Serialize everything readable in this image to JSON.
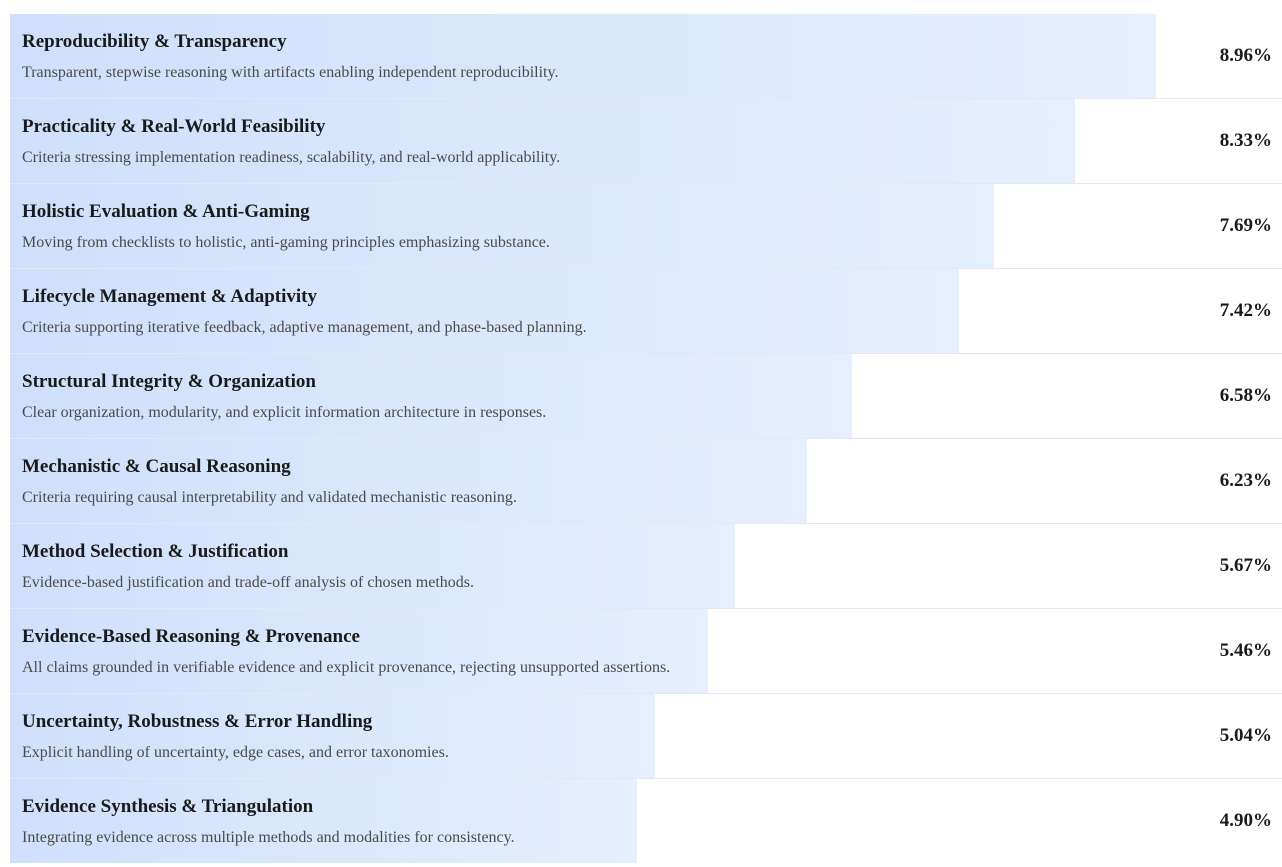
{
  "chart_data": {
    "type": "bar",
    "orientation": "horizontal",
    "xlim": [
      0,
      8.96
    ],
    "colors": {
      "bar_start": "#cfe0fc",
      "bar_end": "#e6effd",
      "text": "#1a1a1a",
      "subtext": "#4a4a4a",
      "divider": "#e6e8ee"
    },
    "rows": [
      {
        "title": "Reproducibility & Transparency",
        "description": "Transparent, stepwise reasoning with artifacts enabling independent reproducibility.",
        "value": 8.96,
        "label": "8.96%"
      },
      {
        "title": "Practicality & Real-World Feasibility",
        "description": "Criteria stressing implementation readiness, scalability, and real-world applicability.",
        "value": 8.33,
        "label": "8.33%"
      },
      {
        "title": "Holistic Evaluation & Anti-Gaming",
        "description": "Moving from checklists to holistic, anti-gaming principles emphasizing substance.",
        "value": 7.69,
        "label": "7.69%"
      },
      {
        "title": "Lifecycle Management & Adaptivity",
        "description": "Criteria supporting iterative feedback, adaptive management, and phase-based planning.",
        "value": 7.42,
        "label": "7.42%"
      },
      {
        "title": "Structural Integrity & Organization",
        "description": "Clear organization, modularity, and explicit information architecture in responses.",
        "value": 6.58,
        "label": "6.58%"
      },
      {
        "title": "Mechanistic & Causal Reasoning",
        "description": "Criteria requiring causal interpretability and validated mechanistic reasoning.",
        "value": 6.23,
        "label": "6.23%"
      },
      {
        "title": "Method Selection & Justification",
        "description": "Evidence-based justification and trade-off analysis of chosen methods.",
        "value": 5.67,
        "label": "5.67%"
      },
      {
        "title": "Evidence-Based Reasoning & Provenance",
        "description": "All claims grounded in verifiable evidence and explicit provenance, rejecting unsupported assertions.",
        "value": 5.46,
        "label": "5.46%"
      },
      {
        "title": "Uncertainty, Robustness & Error Handling",
        "description": "Explicit handling of uncertainty, edge cases, and error taxonomies.",
        "value": 5.04,
        "label": "5.04%"
      },
      {
        "title": "Evidence Synthesis & Triangulation",
        "description": "Integrating evidence across multiple methods and modalities for consistency.",
        "value": 4.9,
        "label": "4.90%"
      }
    ]
  }
}
